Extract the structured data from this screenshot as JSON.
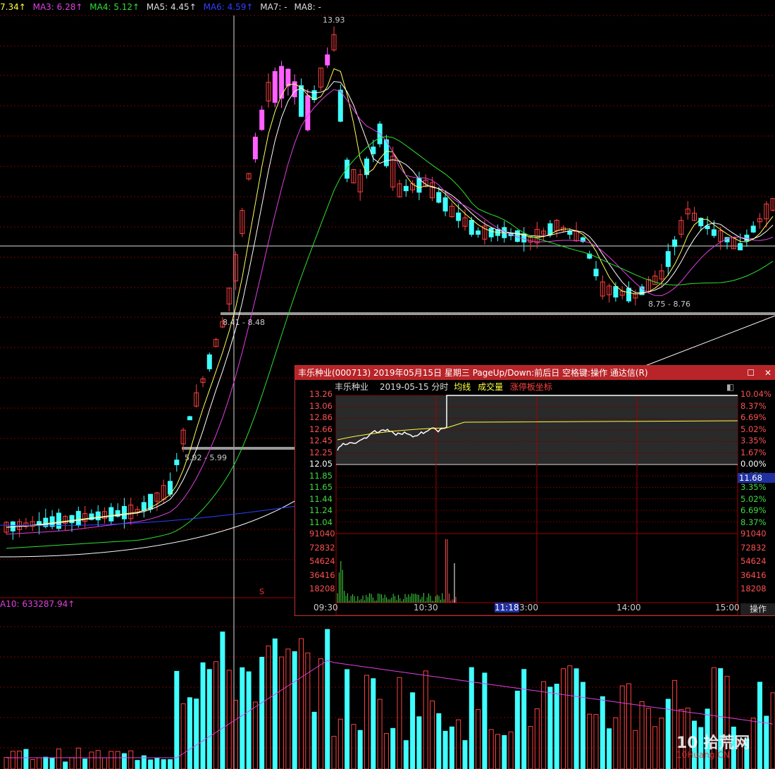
{
  "main_legend": [
    {
      "text": "7.34↑",
      "color": "#ffff40"
    },
    {
      "text": "MA3: 6.28↑",
      "color": "#e040e0"
    },
    {
      "text": "MA4: 5.12↑",
      "color": "#30e030"
    },
    {
      "text": "MA5: 4.45↑",
      "color": "#dddddd"
    },
    {
      "text": "MA6: 4.59↑",
      "color": "#3040ff"
    },
    {
      "text": "MA7: -",
      "color": "#dddddd"
    },
    {
      "text": "MA8: -",
      "color": "#dddddd"
    }
  ],
  "volume_legend": "A10: 633287.94↑",
  "annotations": {
    "high": "13.93",
    "range1": "8.41 - 8.48",
    "range2": "8.75 - 8.76",
    "range3": "5.92 - 5.99",
    "marker": "S"
  },
  "popup": {
    "title": "丰乐种业(000713) 2019年05月15日 星期三 PageUp/Down:前后日 空格键:操作 通达信(R)",
    "stock_name": "丰乐种业",
    "date_label": "2019-05-15 分时",
    "tab_avg": "均线",
    "tab_volume": "成交量",
    "tab_limit": "涨停板坐标",
    "price_left": [
      "13.26",
      "13.06",
      "12.86",
      "12.66",
      "12.45",
      "12.25",
      "12.05",
      "11.85",
      "11.65",
      "11.44",
      "11.24",
      "11.04"
    ],
    "pct_right": [
      "10.04%",
      "8.37%",
      "6.69%",
      "5.02%",
      "3.35%",
      "1.67%",
      "0.00%",
      "1.67%",
      "3.35%",
      "5.02%",
      "6.69%",
      "8.37%"
    ],
    "current_price": "11.68",
    "vol_ticks": [
      "91040",
      "72832",
      "54624",
      "36416",
      "18208"
    ],
    "time_labels": [
      "09:30",
      "10:30",
      "11:18",
      "3:00",
      "14:00",
      "15:00"
    ],
    "op_button": "操作"
  },
  "watermark": {
    "main": "10 拾荒网",
    "sub": "10Huang.CN"
  },
  "chart_data": {
    "type": "candlestick",
    "series_names": [
      "MA3",
      "MA4",
      "MA5",
      "MA6"
    ],
    "intraday": {
      "type": "line",
      "prev_close": 12.05,
      "limit_up": 13.26,
      "open": 12.3,
      "high": 13.26,
      "close": 13.26
    }
  }
}
